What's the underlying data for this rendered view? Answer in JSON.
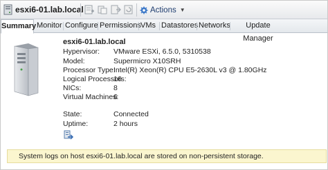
{
  "header": {
    "host_title": "esxi6-01.lab.local",
    "actions_label": "Actions",
    "toolbar_icons": [
      "host-icon",
      "add-vm-icon",
      "new-vapp-icon",
      "enter-maintenance-icon",
      "reboot-icon",
      "settings-icon",
      "actions-icon"
    ]
  },
  "tabs": [
    {
      "label": "Summary"
    },
    {
      "label": "Monitor"
    },
    {
      "label": "Configure"
    },
    {
      "label": "Permissions"
    },
    {
      "label": "VMs"
    },
    {
      "label": "Datastores"
    },
    {
      "label": "Networks"
    },
    {
      "label": "Update Manager"
    }
  ],
  "summary": {
    "host_name": "esxi6-01.lab.local",
    "details": [
      {
        "label": "Hypervisor:",
        "value": "VMware ESXi, 6.5.0, 5310538"
      },
      {
        "label": "Model:",
        "value": "Supermicro X10SRH"
      },
      {
        "label": "Processor Type:",
        "value": "Intel(R) Xeon(R) CPU E5-2630L v3 @ 1.80GHz"
      },
      {
        "label": "Logical Processors:",
        "value": "16"
      },
      {
        "label": "NICs:",
        "value": "8"
      },
      {
        "label": "Virtual Machines:",
        "value": "6"
      }
    ],
    "state_label": "State:",
    "state_value": "Connected",
    "uptime_label": "Uptime:",
    "uptime_value": "2 hours"
  },
  "warning": {
    "text": "System logs on host esxi6-01.lab.local are stored on non-persistent storage."
  },
  "colors": {
    "accent": "#1e3c6e",
    "warning_bg": "#fbf6cf",
    "tab_border": "#b9c0c8"
  }
}
